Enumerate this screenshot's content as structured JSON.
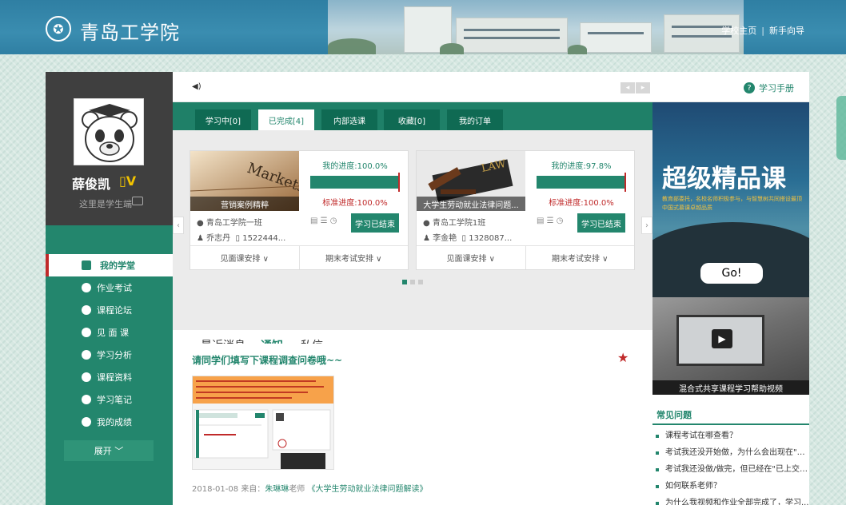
{
  "header": {
    "logo_text": "青岛工学院",
    "links": [
      "学校主页",
      "新手向导"
    ]
  },
  "profile": {
    "name": "薛俊凯",
    "level": "▯V",
    "subtitle": "这里是学生端"
  },
  "sidebar": {
    "items": [
      {
        "label": "我的学堂",
        "icon": "home-icon",
        "active": true
      },
      {
        "label": "作业考试",
        "icon": "pencil-icon"
      },
      {
        "label": "课程论坛",
        "icon": "circle-icon"
      },
      {
        "label": "见 面 课",
        "icon": "meeting-icon"
      },
      {
        "label": "学习分析",
        "icon": "chart-icon"
      },
      {
        "label": "课程资料",
        "icon": "box-icon"
      },
      {
        "label": "学习笔记",
        "icon": "note-icon"
      },
      {
        "label": "我的成绩",
        "icon": "check-icon"
      }
    ],
    "expand_label": "展开 ﹀"
  },
  "topbar": {
    "pager_prev": "◂",
    "pager_next": "▸",
    "handbook": "学习手册"
  },
  "course_tabs": [
    "学习中[0]",
    "已完成[4]",
    "内部选课",
    "收藏[0]",
    "我的订单"
  ],
  "courses": [
    {
      "title": "营销案例精粹",
      "progress_label": "我的进度:100.0%",
      "progress": 100.0,
      "standard_label": "标准进度:100.0%",
      "school": "青岛工学院一班",
      "teacher": "乔志丹",
      "phone": "1522444...",
      "button": "学习已结束",
      "foot": [
        "见面课安排 ∨",
        "期末考试安排 ∨"
      ]
    },
    {
      "title": "大学生劳动就业法律问题...",
      "progress_label": "我的进度:97.8%",
      "progress": 97.8,
      "standard_label": "标准进度:100.0%",
      "school": "青岛工学院1班",
      "teacher": "李金艳",
      "phone": "1328087...",
      "button": "学习已结束",
      "foot": [
        "见面课安排 ∨",
        "期末考试安排 ∨"
      ]
    }
  ],
  "message_tabs": [
    "最近消息",
    "通知",
    "私信"
  ],
  "notice": {
    "title": "请同学们填写下课程调查问卷哦~~",
    "date": "2018-01-08",
    "from_label": "来自：",
    "teacher": "朱琳琳",
    "teacher_suffix": "老师",
    "course": "《大学生劳动就业法律问题解读》"
  },
  "banner": {
    "title": "超级精品课",
    "subtitle": "教育部委托，名校名师积极参与，与智慧树共同搭设最顶中国式慕课卓越品质",
    "go": "Go!"
  },
  "video": {
    "caption": "混合式共享课程学习帮助视频"
  },
  "faq": {
    "title": "常见问题",
    "items": [
      "课程考试在哪查看？",
      "考试我还没开始做，为什么会出现在\"已...",
      "考试我还没做/做完，但已经在\"已上交\"...",
      "如何联系老师？",
      "为什么我视频和作业全部完成了，学习..."
    ]
  },
  "colors": {
    "primary": "#23866d",
    "header": "#2f7fa3",
    "alert": "#c02a2a"
  }
}
